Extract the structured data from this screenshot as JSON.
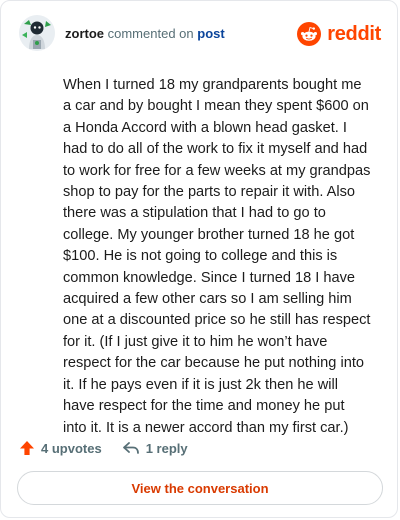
{
  "header": {
    "username": "zortoe",
    "action_text": "commented on",
    "target_text": "post",
    "brand_name": "reddit",
    "brand_color": "#ff4500"
  },
  "comment": {
    "body": "When I turned 18 my grandparents bought me a car and by bought I mean they spent $600 on a Honda Accord with a blown head gasket. I had to do all of the work to fix it myself and had to work for free for a few weeks at my grandpas shop to pay for the parts to repair it with. Also there was a stipulation that I had to go to college. My younger brother turned 18 he got $100. He is not going to college and this is common knowledge. Since I turned 18 I have acquired a few other cars so I am selling him one at a discounted price so he still has respect for it. (If I just give it to him he won’t have respect for the car because he put nothing into it. If he pays even if it is just 2k then he will have respect for the time and money he put into it. It is a newer accord than my first car.)"
  },
  "footer": {
    "upvotes_label": "4 upvotes",
    "replies_label": "1 reply",
    "upvote_icon": "upvote-arrow-icon",
    "reply_icon": "reply-arrow-icon",
    "upvote_color": "#ff4500",
    "view_button_label": "View the conversation",
    "view_button_color": "#d93a00"
  }
}
